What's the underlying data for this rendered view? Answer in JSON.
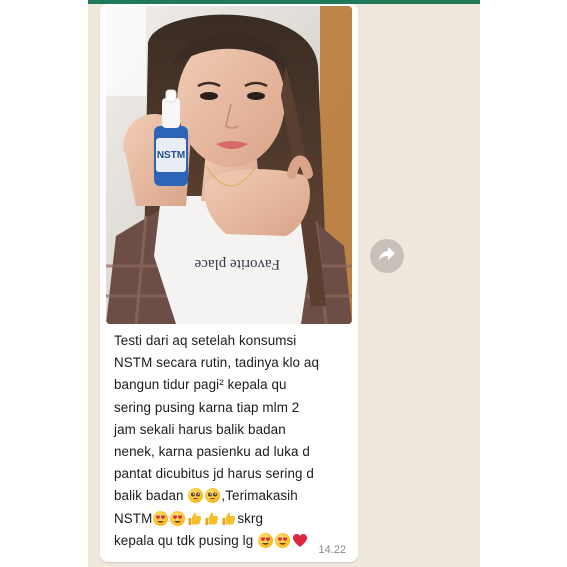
{
  "chat": {
    "message_lines": [
      "Testi dari aq setelah konsumsi",
      "NSTM secara rutin, tadinya klo aq",
      "bangun tidur pagi² kepala qu",
      "sering pusing karna tiap mlm 2",
      "jam sekali  harus balik badan",
      "nenek, karna pasienku ad luka d",
      "pantat dicubitus jd harus sering d"
    ],
    "line8_a": "balik badan ",
    "line8_b": ",Terimakasih",
    "line9_a": "NSTM",
    "line9_b": "skrg",
    "line10_a": "kepala qu tdk pusing lg ",
    "timestamp": "14.22"
  },
  "photo": {
    "bottle_label": "NSTM",
    "shirt_text": "Favorite place"
  },
  "icons": {
    "forward": "forward-arrow-icon",
    "emoji_smile_hearts": "smiling-face-with-heart-eyes",
    "emoji_pleading": "pleading-face",
    "emoji_thumbs": "thumbs-up",
    "emoji_heart": "red-heart"
  },
  "colors": {
    "chat_background": "#efe6dc",
    "bubble": "#ffffff",
    "accent_strip": "#1f7a5c",
    "forward_button": "#c9c1b9"
  }
}
